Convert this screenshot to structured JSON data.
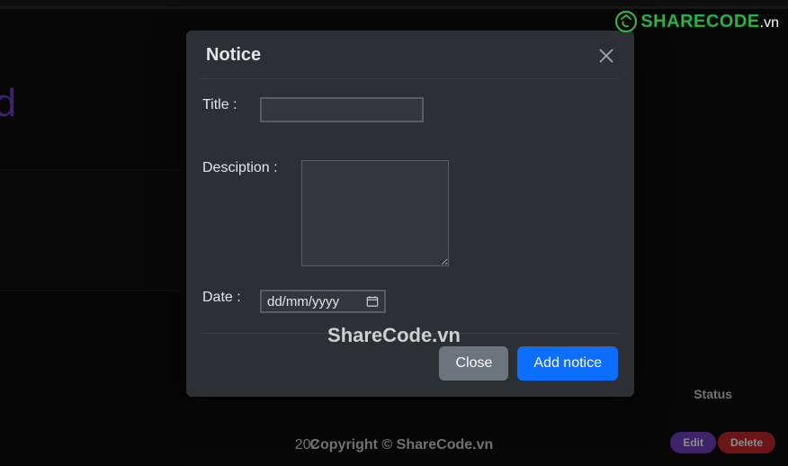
{
  "background": {
    "heading_fragment": "oard",
    "status_col_header": "Status",
    "copyright_year_fragment": "202",
    "copyright_text": "Copyright © ShareCode.vn",
    "edit_button_label": "Edit",
    "delete_button_label": "Delete"
  },
  "modal": {
    "title": "Notice",
    "labels": {
      "title": "Title :",
      "description": "Desciption :",
      "date": "Date :"
    },
    "fields": {
      "title_value": "",
      "description_value": "",
      "date_placeholder": "dd/mm/yyyy"
    },
    "buttons": {
      "close": "Close",
      "add": "Add notice"
    }
  },
  "watermark": {
    "logo_share": "SHARE",
    "logo_code": "CODE",
    "logo_domain": ".vn",
    "center": "ShareCode.vn"
  }
}
